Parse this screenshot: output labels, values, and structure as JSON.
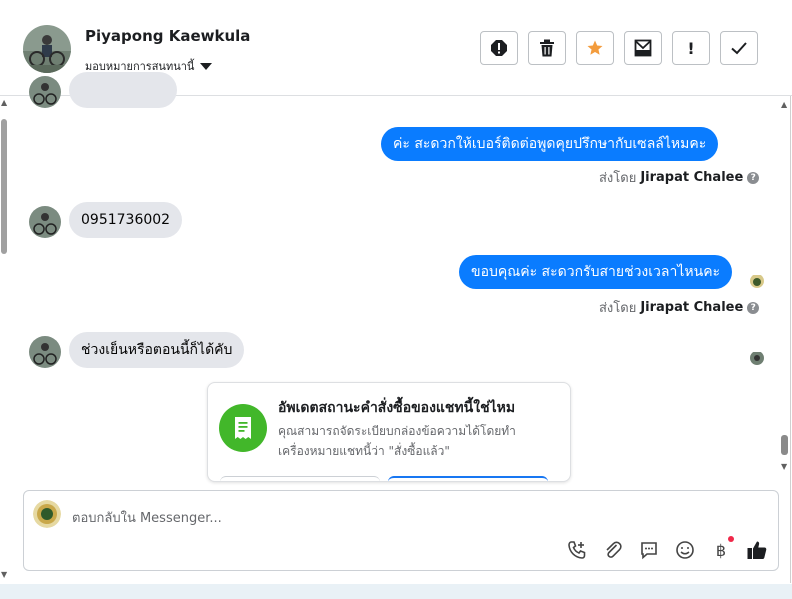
{
  "header": {
    "contact_name": "Piyapong Kaewkula",
    "assign_label": "มอบหมายการสนทนานี้",
    "toolbar": [
      "spam-icon",
      "trash-icon",
      "star-icon",
      "archive-icon",
      "exclamation-icon",
      "check-icon"
    ],
    "toolbar_symbols": {
      "exclamation": "!"
    }
  },
  "messages": [
    {
      "side": "in",
      "text": ""
    },
    {
      "side": "out",
      "text": "ค่ะ สะดวกให้เบอร์ติดต่อพูดคุยปรึกษากับเซลล์ไหมคะ",
      "sent_by_label": "ส่งโดย",
      "sent_by_name": "Jirapat Chalee"
    },
    {
      "side": "in",
      "text": "0951736002"
    },
    {
      "side": "out",
      "text": "ขอบคุณค่ะ สะดวกรับสายช่วงเวลาไหนคะ",
      "sent_by_label": "ส่งโดย",
      "sent_by_name": "Jirapat Chalee"
    },
    {
      "side": "in",
      "text": "ช่วงเย็นหรือตอนนี้ก็ได้คับ"
    }
  ],
  "card": {
    "title": "อัพเดตสถานะคำสั่งซื้อของแชทนี้ใช่ไหม",
    "description": "คุณสามารถจัดระเบียบกล่องข้อความได้โดยทำเครื่องหมายแชทนี้ว่า \"สั่งซื้อแล้ว\""
  },
  "composer": {
    "placeholder": "ตอบกลับใน Messenger...",
    "baht_symbol": "฿"
  },
  "colors": {
    "accent": "#0a7cff",
    "incoming_bubble": "#e4e6eb",
    "card_icon": "#42b72a",
    "star": "#f39c3d",
    "notification_dot": "#f02849"
  }
}
